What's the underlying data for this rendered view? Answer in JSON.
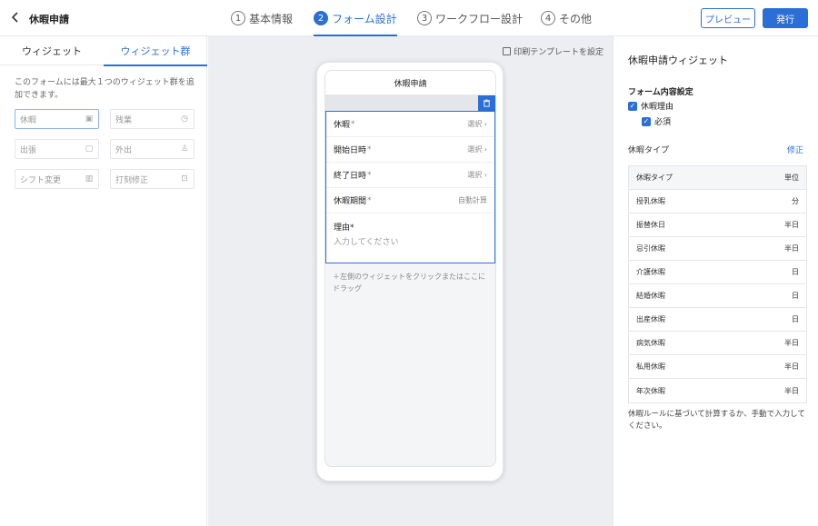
{
  "header": {
    "back_icon": "chevron-left-icon",
    "title": "休暇申請",
    "steps": [
      {
        "num": "1",
        "label": "基本情報"
      },
      {
        "num": "2",
        "label": "フォーム設計"
      },
      {
        "num": "3",
        "label": "ワークフロー設計"
      },
      {
        "num": "4",
        "label": "その他"
      }
    ],
    "preview_label": "プレビュー",
    "publish_label": "発行"
  },
  "left": {
    "tabs": [
      "ウィジェット",
      "ウィジェット群"
    ],
    "note": "このフォームには最大１つのウィジェット群を追加できます。",
    "widgets": [
      "休暇",
      "残業",
      "出張",
      "外出",
      "シフト変更",
      "打刻修正"
    ]
  },
  "center": {
    "print_label": "印刷テンプレートを設定",
    "phone_title": "休暇申請",
    "fields": [
      {
        "label": "休暇",
        "value": "選択 ›"
      },
      {
        "label": "開始日時",
        "value": "選択 ›"
      },
      {
        "label": "終了日時",
        "value": "選択 ›"
      },
      {
        "label": "休暇期間",
        "value": "自動計算"
      }
    ],
    "required_mark": "*",
    "reason_label": "理由",
    "reason_placeholder": "入力してください",
    "drop_tip": "左側のウィジェットをクリックまたはここにドラッグ"
  },
  "right": {
    "title": "休暇申請ウィジェット",
    "section": "フォーム内容設定",
    "check1": "休暇理由",
    "check2": "必須",
    "type_label": "休暇タイプ",
    "edit_label": "修正",
    "table_head": [
      "休暇タイプ",
      "単位"
    ],
    "rows": [
      [
        "授乳休暇",
        "分"
      ],
      [
        "振替休日",
        "半日"
      ],
      [
        "忌引休暇",
        "半日"
      ],
      [
        "介護休暇",
        "日"
      ],
      [
        "結婚休暇",
        "日"
      ],
      [
        "出産休暇",
        "日"
      ],
      [
        "病気休暇",
        "半日"
      ],
      [
        "私用休暇",
        "半日"
      ],
      [
        "年次休暇",
        "半日"
      ]
    ],
    "note": "休暇ルールに基づいて計算するか、手動で入力してください。"
  },
  "colors": {
    "accent": "#2b6fd6"
  }
}
